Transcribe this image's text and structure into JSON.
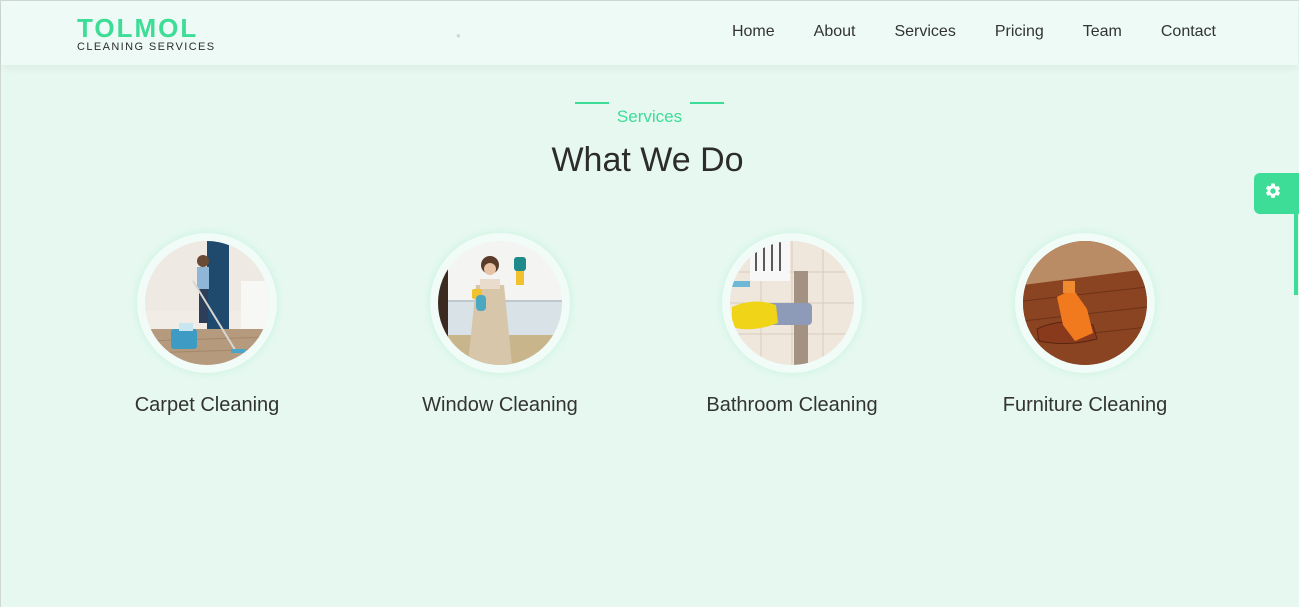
{
  "brand": {
    "name": "TOLMOL",
    "tagline": "CLEANING SERVICES"
  },
  "nav": {
    "items": [
      "Home",
      "About",
      "Services",
      "Pricing",
      "Team",
      "Contact"
    ]
  },
  "section": {
    "kicker": "Services",
    "title": "What We Do"
  },
  "services": [
    {
      "label": "Carpet Cleaning",
      "icon": "carpet-cleaning-photo"
    },
    {
      "label": "Window Cleaning",
      "icon": "window-cleaning-photo"
    },
    {
      "label": "Bathroom Cleaning",
      "icon": "bathroom-cleaning-photo"
    },
    {
      "label": "Furniture Cleaning",
      "icon": "furniture-cleaning-photo"
    }
  ],
  "settings": {
    "icon": "gear-icon"
  },
  "colors": {
    "accent": "#3ddc97",
    "background": "#e6f8f0",
    "navbar": "#eefaf6",
    "text": "#333333"
  }
}
